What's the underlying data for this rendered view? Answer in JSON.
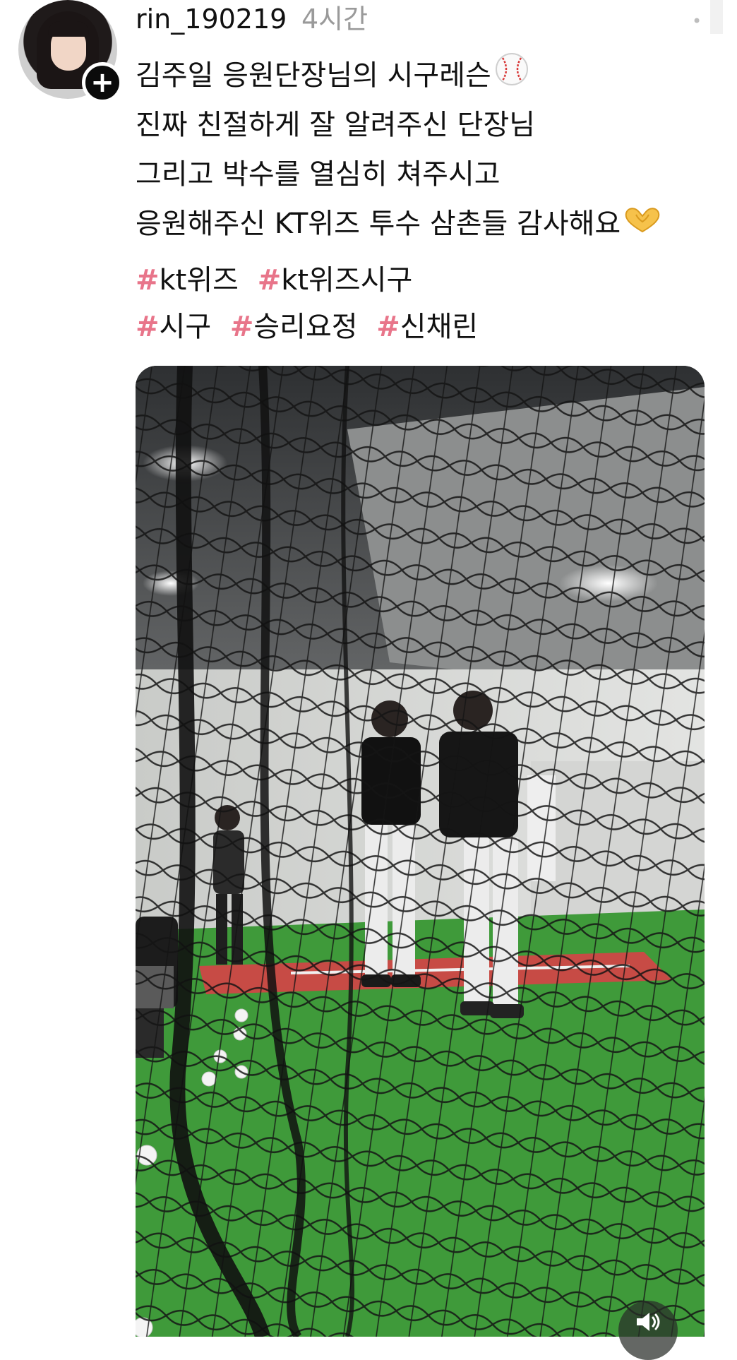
{
  "post": {
    "username": "rin_190219",
    "timestamp": "4시간",
    "caption_lines": [
      "김주일 응원단장님의 시구레슨",
      "진짜 친절하게 잘 알려주신 단장님",
      "그리고 박수를 열심히 쳐주시고",
      "응원해주신 KT위즈 투수 삼촌들 감사해요"
    ],
    "caption_emojis": [
      "baseball-emoji",
      "heart-hands-emoji"
    ],
    "hashtag_rows": [
      [
        {
          "hash": "#",
          "text": "kt위즈"
        },
        {
          "hash": "#",
          "text": "kt위즈시구"
        }
      ],
      [
        {
          "hash": "#",
          "text": "시구"
        },
        {
          "hash": "#",
          "text": "승리요정"
        },
        {
          "hash": "#",
          "text": "신채린"
        }
      ]
    ],
    "icons": {
      "avatar": "profile-avatar",
      "follow": "plus-icon",
      "more": "more-dots-icon",
      "sound": "speaker-icon"
    }
  },
  "colors": {
    "hashtag_hash": "#e8758a",
    "text": "#111111",
    "timestamp": "#9a9a9a",
    "turf": "#3f9a3a",
    "netting": "#141414"
  }
}
